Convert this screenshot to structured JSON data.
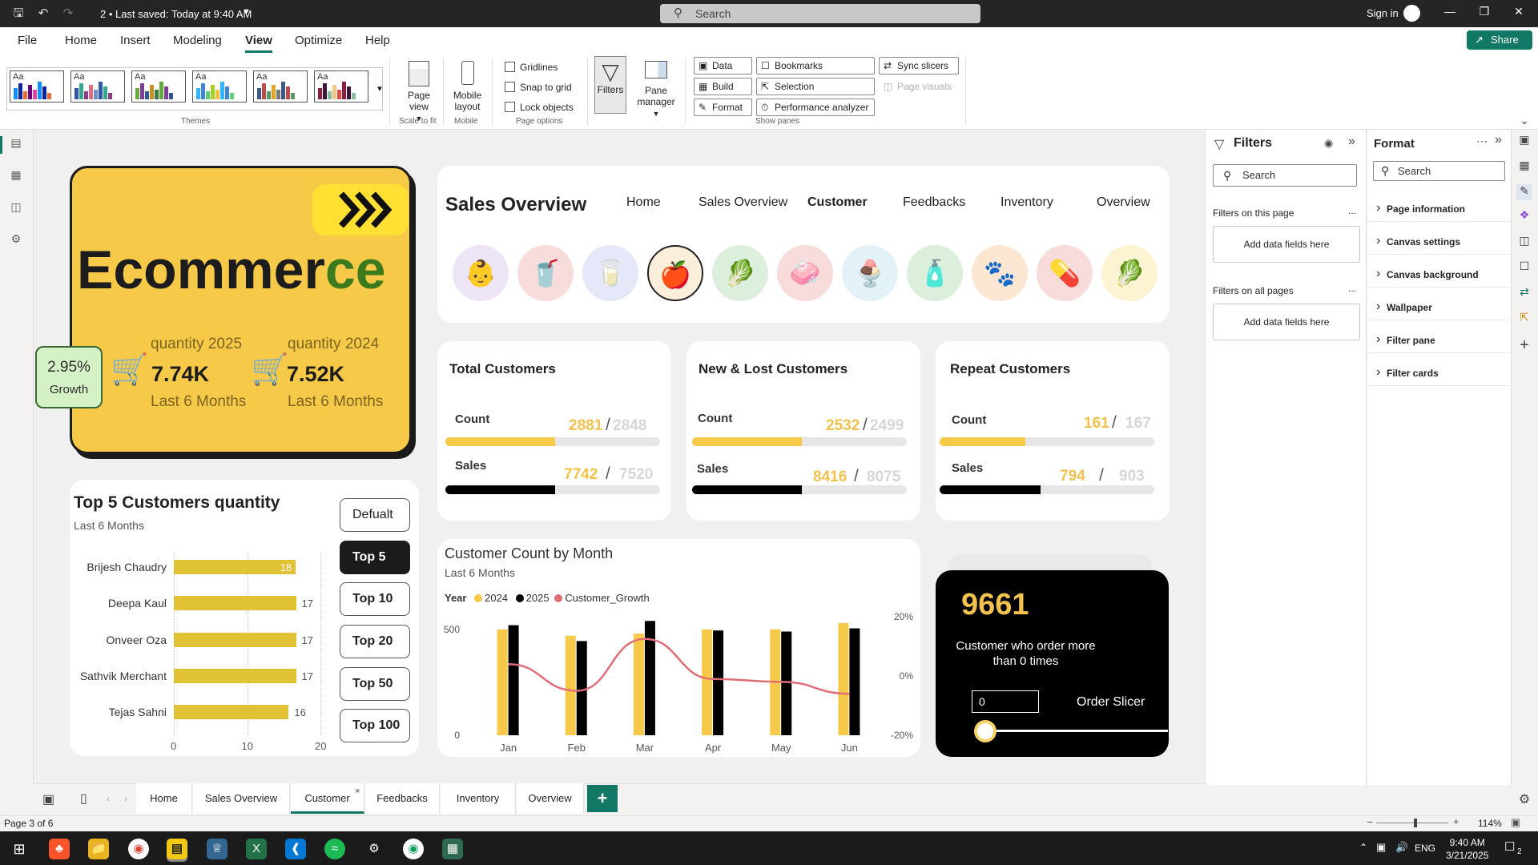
{
  "titlebar": {
    "saved_text": "2 • Last saved: Today at 9:40 AM",
    "search_placeholder": "Search",
    "signin": "Sign in"
  },
  "menu": {
    "items": [
      "File",
      "Home",
      "Insert",
      "Modeling",
      "View",
      "Optimize",
      "Help"
    ],
    "active": "View",
    "share": "Share"
  },
  "ribbon": {
    "themes_label": "Themes",
    "page_view": "Page view",
    "mobile_layout": "Mobile layout",
    "scale_to_fit": "Scale to fit",
    "mobile": "Mobile",
    "gridlines": "Gridlines",
    "snap_to_grid": "Snap to grid",
    "lock_objects": "Lock objects",
    "page_options": "Page options",
    "filters": "Filters",
    "pane_manager": "Pane manager",
    "data": "Data",
    "build": "Build",
    "format": "Format",
    "bookmarks": "Bookmarks",
    "selection": "Selection",
    "performance_analyzer": "Performance analyzer",
    "sync_slicers": "Sync slicers",
    "page_visuals": "Page visuals",
    "show_panes": "Show panes",
    "theme_aa": "Aa"
  },
  "hero": {
    "title_main": "Ecommer",
    "title_accent": "ce",
    "qty_2025_label": "quantity 2025",
    "qty_2025_value": "7.74K",
    "qty_2024_label": "quantity 2024",
    "qty_2024_value": "7.52K",
    "period": "Last 6 Months",
    "growth_value": "2.95%",
    "growth_label": "Growth"
  },
  "nav": {
    "title": "Sales Overview",
    "links": [
      "Home",
      "Sales Overview",
      "Customer",
      "Feedbacks",
      "Inventory",
      "Overview"
    ],
    "active": "Customer"
  },
  "kpis": [
    {
      "title": "Total Customers",
      "count_label": "Count",
      "count": "2881",
      "count_prev": "2848",
      "sales_label": "Sales",
      "sales": "7742",
      "sales_prev": "7520"
    },
    {
      "title": "New & Lost Customers",
      "count_label": "Count",
      "count": "2532",
      "count_prev": "2499",
      "sales_label": "Sales",
      "sales": "8416",
      "sales_prev": "8075"
    },
    {
      "title": "Repeat Customers",
      "count_label": "Count",
      "count": "161",
      "count_prev": "167",
      "sales_label": "Sales",
      "sales": "794",
      "sales_prev": "903"
    }
  ],
  "top5": {
    "title": "Top 5 Customers quantity",
    "subtitle": "Last 6 Months",
    "buttons": [
      "Defualt",
      "Top 5",
      "Top 10",
      "Top 20",
      "Top 50",
      "Top 100"
    ],
    "selected": "Top 5"
  },
  "customer_chart": {
    "title": "Customer Count by Month",
    "subtitle": "Last 6 Months",
    "legend_title": "Year",
    "legend": [
      "2024",
      "2025",
      "Customer_Growth"
    ]
  },
  "order_card": {
    "value": "9661",
    "description": "Customer who order more than 0 times",
    "input_value": "0",
    "slicer_label": "Order Slicer"
  },
  "filters_pane": {
    "title": "Filters",
    "search": "Search",
    "this_page": "Filters on this page",
    "all_pages": "Filters on all pages",
    "add_fields": "Add data fields here",
    "more": "..."
  },
  "format_pane": {
    "title": "Format",
    "search": "Search",
    "items": [
      "Page information",
      "Canvas settings",
      "Canvas background",
      "Wallpaper",
      "Filter pane",
      "Filter cards"
    ]
  },
  "page_tabs": {
    "tabs": [
      "Home",
      "Sales Overview",
      "Customer",
      "Feedbacks",
      "Inventory",
      "Overview"
    ],
    "active": "Customer",
    "add": "+"
  },
  "status": {
    "page_info": "Page 3 of 6",
    "zoom": "114%"
  },
  "taskbar": {
    "time": "9:40 AM",
    "date": "3/21/2025",
    "lang": "ENG",
    "notif_count": "2"
  },
  "colors": {
    "accent": "#117865",
    "yellow": "#f7c948",
    "bar_yellow": "#e2c235",
    "series_2024": "#f7c948",
    "series_2025": "#000000",
    "growth_line": "#e06c75"
  },
  "chart_data": [
    {
      "type": "bar",
      "orientation": "horizontal",
      "title": "Top 5 Customers quantity",
      "subtitle": "Last 6 Months",
      "categories": [
        "Brijesh Chaudry",
        "Deepa Kaul",
        "Onveer Oza",
        "Sathvik Merchant",
        "Tejas Sahni"
      ],
      "values": [
        18,
        17,
        17,
        17,
        16
      ],
      "xlim": [
        0,
        20
      ],
      "xticks": [
        "0",
        "10",
        "20"
      ]
    },
    {
      "type": "bar",
      "title": "Customer Count by Month",
      "subtitle": "Last 6 Months",
      "categories": [
        "Jan",
        "Feb",
        "Mar",
        "Apr",
        "May",
        "Jun"
      ],
      "series": [
        {
          "name": "2024",
          "values": [
            500,
            470,
            480,
            500,
            500,
            530
          ]
        },
        {
          "name": "2025",
          "values": [
            520,
            445,
            540,
            495,
            490,
            505
          ]
        }
      ],
      "line": {
        "name": "Customer_Growth",
        "values": [
          4,
          -5,
          12.5,
          -1,
          -2,
          -6
        ]
      },
      "ylim": [
        0,
        560
      ],
      "yticks": [
        "0",
        "500"
      ],
      "y2lim": [
        -20,
        20
      ],
      "y2ticks": [
        "20%",
        "0%",
        "-20%"
      ],
      "grid": false,
      "legend": "top-left"
    }
  ]
}
